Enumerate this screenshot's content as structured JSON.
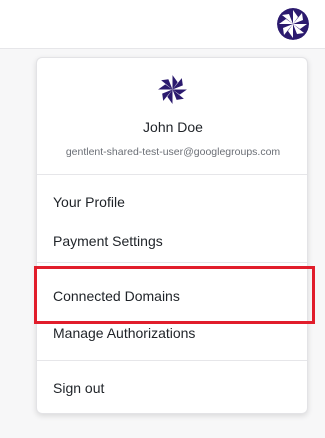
{
  "topbar": {
    "avatar_icon": "user-avatar-icon"
  },
  "menu": {
    "user_name": "John Doe",
    "user_email": "gentlent-shared-test-user@googlegroups.com",
    "items": [
      {
        "label": "Your Profile"
      },
      {
        "label": "Payment Settings"
      },
      {
        "label": "Connected Domains"
      },
      {
        "label": "Manage Authorizations"
      },
      {
        "label": "Sign out"
      }
    ],
    "highlighted_item": "Connected Domains"
  },
  "colors": {
    "avatar": "#2b1a6e",
    "highlight": "#e11d2b",
    "text": "#1f2328",
    "muted": "#6b6f76"
  }
}
